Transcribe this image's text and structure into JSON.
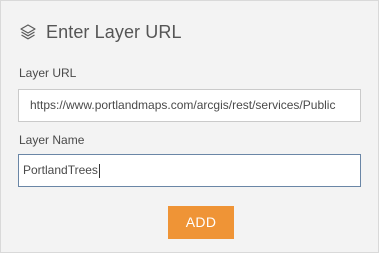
{
  "dialog": {
    "title": "Enter Layer URL",
    "icon": "layers-icon"
  },
  "form": {
    "url_label": "Layer URL",
    "url_value": "https://www.portlandmaps.com/arcgis/rest/services/Public",
    "name_label": "Layer Name",
    "name_value": "PortlandTrees",
    "add_label": "ADD"
  },
  "colors": {
    "panel_bg": "#f3f3f3",
    "accent": "#ef9436",
    "focused_border": "#6a86a6"
  }
}
